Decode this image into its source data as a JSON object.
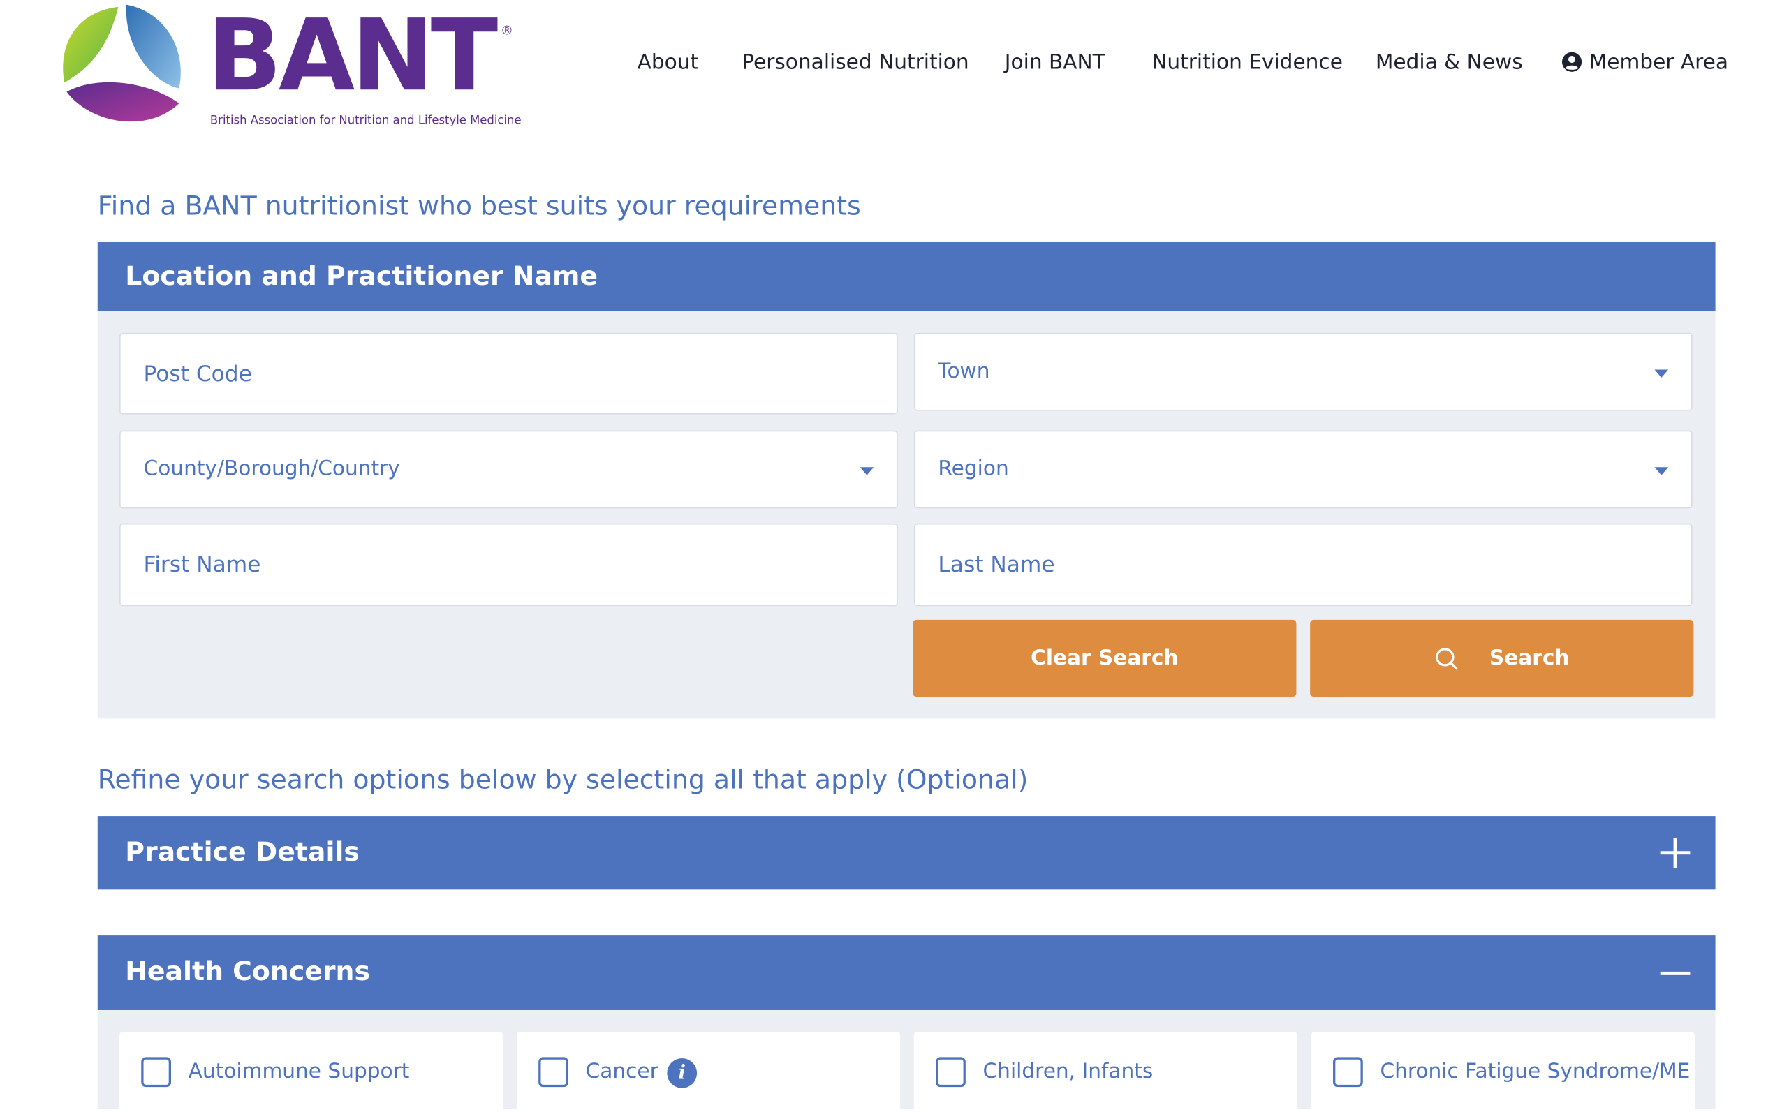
{
  "brand": {
    "name": "BANT",
    "registered": "®",
    "tagline": "British Association for Nutrition and Lifestyle Medicine",
    "colors": {
      "purple": "#5b2d8e",
      "green": "#8cc63f",
      "blue": "#5b8ed0",
      "magenta": "#7b2f9e"
    }
  },
  "nav": {
    "items": [
      "About",
      "Personalised Nutrition",
      "Join BANT",
      "Nutrition Evidence",
      "Media & News"
    ],
    "member": {
      "label": "Member Area",
      "icon": "user-circle-icon"
    }
  },
  "search": {
    "intro": "Find a BANT nutritionist who best suits your requirements",
    "panel_title": "Location and Practitioner Name",
    "fields": {
      "postcode_placeholder": "Post Code",
      "town_label": "Town",
      "county_label": "County/Borough/Country",
      "region_label": "Region",
      "first_name_placeholder": "First Name",
      "last_name_placeholder": "Last Name"
    },
    "buttons": {
      "clear": "Clear Search",
      "search": "Search",
      "search_icon": "search-icon"
    }
  },
  "refine": {
    "intro": "Refine your search options below by selecting all that apply (Optional)",
    "practice_details": {
      "title": "Practice Details",
      "state": "collapsed",
      "icon": "plus-icon"
    },
    "health_concerns": {
      "title": "Health Concerns",
      "state": "expanded",
      "icon": "minus-icon",
      "options": [
        {
          "label": "Autoimmune Support",
          "checked": false
        },
        {
          "label": "Cancer",
          "checked": false,
          "info_icon": true
        },
        {
          "label": "Children, Infants",
          "checked": false
        },
        {
          "label": "Chronic Fatigue Syndrome/ME",
          "checked": false
        }
      ]
    }
  },
  "theme": {
    "accent_blue": "#4d72be",
    "button_orange": "#de8c40",
    "panel_bg": "#ebeef2"
  }
}
